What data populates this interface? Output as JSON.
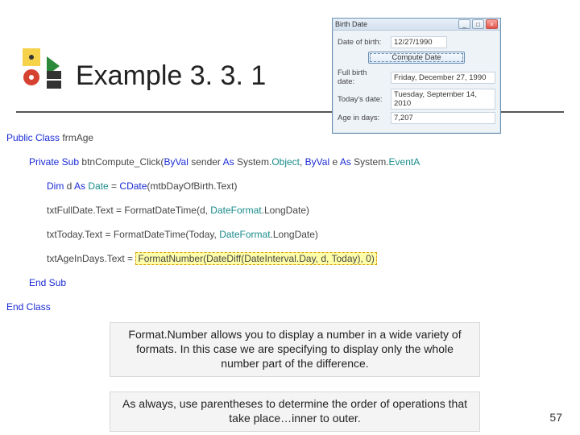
{
  "slide": {
    "title": "Example 3. 3. 1",
    "pagenum": "57"
  },
  "appwindow": {
    "title": "Birth Date",
    "min": "_",
    "max": "□",
    "close": "×",
    "labels": {
      "dob": "Date of birth:",
      "full": "Full birth date:",
      "today": "Today's date:",
      "age": "Age in days:"
    },
    "values": {
      "dob": "12/27/1990",
      "full": "Friday, December 27, 1990",
      "today": "Tuesday, September 14, 2010",
      "age": "7,207"
    },
    "compute": "Compute Date"
  },
  "code": {
    "l1_kw1": "Public Class",
    "l1_id": "frmAge",
    "l2_kw1": "Private Sub",
    "l2_id": "btnCompute_Click(",
    "l2_kw2": "ByVal",
    "l2_t1": " sender ",
    "l2_kw3": "As",
    "l2_t2": " System.",
    "l2_typ1": "Object",
    "l2_c": ", ",
    "l2_kw4": "ByVal",
    "l2_t3": " e ",
    "l2_kw5": "As",
    "l2_t4": " System.",
    "l2_typ2": "EventA",
    "l3_kw1": "Dim",
    "l3_t1": " d ",
    "l3_kw2": "As",
    "l3_typ": " Date",
    "l3_t2": " = ",
    "l3_kw3": "CDate",
    "l3_t3": "(mtbDayOfBirth.Text)",
    "l4_t1": "txtFullDate.Text = FormatDateTime(d, ",
    "l4_typ": "DateFormat",
    "l4_t2": ".LongDate)",
    "l5_t1": "txtToday.Text = FormatDateTime(Today, ",
    "l5_typ": "DateFormat",
    "l5_t2": ".LongDate)",
    "l6_t1": "txtAgeInDays.Text = ",
    "l6_hl": "FormatNumber(DateDiff(DateInterval.Day, d, Today), 0)",
    "l7_kw": "End Sub",
    "l8_kw": "End Class"
  },
  "captions": {
    "top": "Format.Number allows you to display a number in a wide variety of formats. In this case we are specifying to display only the whole number part of the difference.",
    "bot": "As always, use parentheses to determine the order of operations that take place…inner to outer."
  }
}
